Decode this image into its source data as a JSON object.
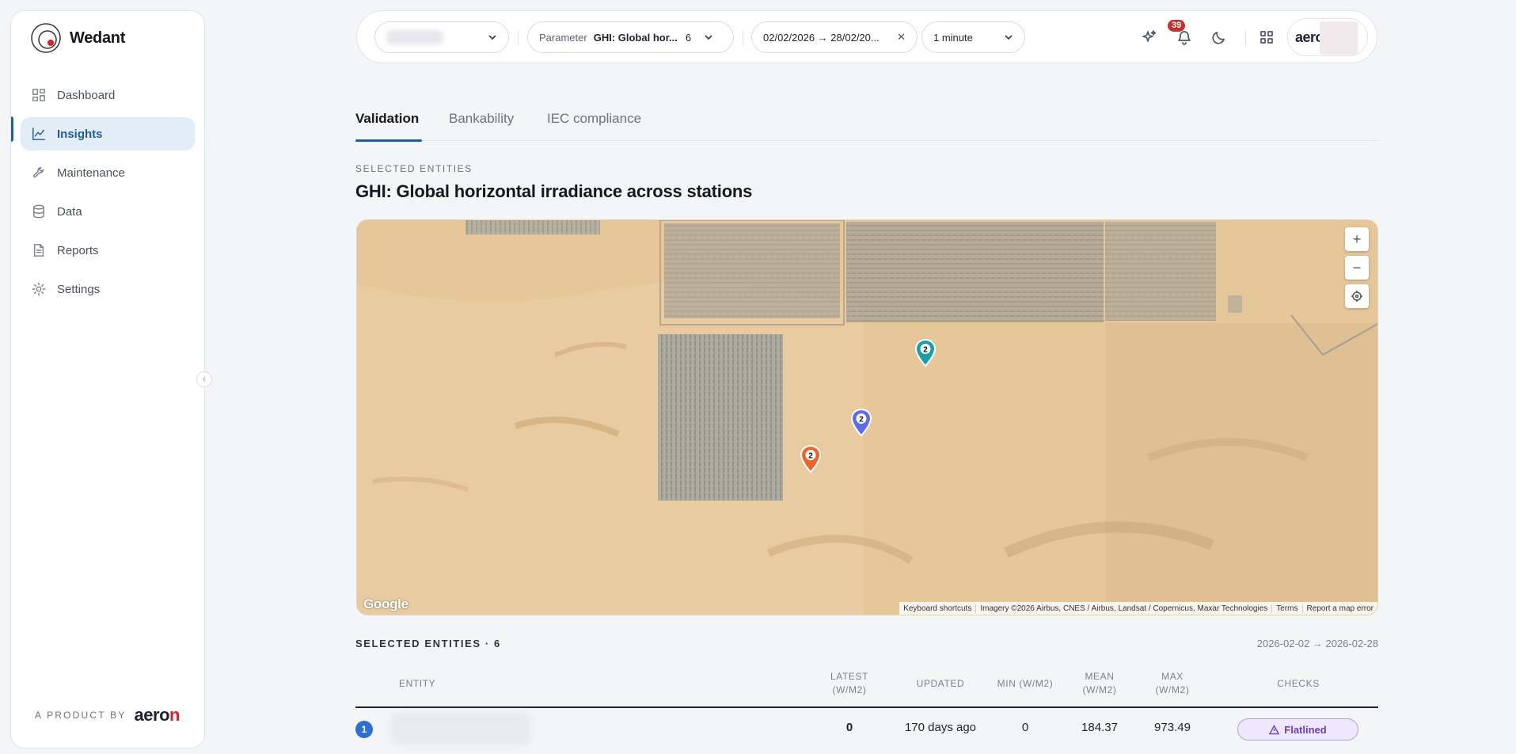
{
  "brand": {
    "name": "Wedant"
  },
  "sidebar": {
    "items": [
      {
        "label": "Dashboard",
        "icon": "dashboard-icon"
      },
      {
        "label": "Insights",
        "icon": "chart-line-icon",
        "active": true
      },
      {
        "label": "Maintenance",
        "icon": "wrench-icon"
      },
      {
        "label": "Data",
        "icon": "database-icon"
      },
      {
        "label": "Reports",
        "icon": "report-icon"
      },
      {
        "label": "Settings",
        "icon": "gear-icon"
      }
    ],
    "product_by": "A PRODUCT BY",
    "product_logo": {
      "prefix": "aero",
      "suffix": "n"
    }
  },
  "topbar": {
    "parameter_label": "Parameter",
    "parameter_value": "GHI: Global hor...",
    "parameter_count": "6",
    "date_range": "02/02/2026 → 28/02/20...",
    "interval": "1 minute",
    "notifications_count": "39",
    "account_logo": "aero"
  },
  "tabs": [
    {
      "label": "Validation",
      "active": true
    },
    {
      "label": "Bankability"
    },
    {
      "label": "IEC compliance"
    }
  ],
  "section": {
    "eyebrow": "SELECTED ENTITIES",
    "title": "GHI: Global horizontal irradiance across stations"
  },
  "map": {
    "zoom_in": "+",
    "zoom_out": "−",
    "google_logo": "Google",
    "attribution": [
      "Keyboard shortcuts",
      "Imagery ©2026 Airbus, CNES / Airbus, Landsat / Copernicus, Maxar Technologies",
      "Terms",
      "Report a map error"
    ],
    "markers": [
      {
        "count": "2",
        "color": "#17a0a8"
      },
      {
        "count": "2",
        "color": "#5b6cf0"
      },
      {
        "count": "2",
        "color": "#f1632c"
      }
    ]
  },
  "table": {
    "heading": "SELECTED ENTITIES · 6",
    "range": "2026-02-02 → 2026-02-28",
    "columns": {
      "entity": "ENTITY",
      "latest": "LATEST\n(W/M2)",
      "updated": "UPDATED",
      "min": "MIN (W/M2)",
      "mean": "MEAN\n(W/M2)",
      "max": "MAX\n(W/M2)",
      "checks": "CHECKS"
    },
    "rows": [
      {
        "index": "1",
        "latest": "0",
        "updated": "170 days ago",
        "min": "0",
        "mean": "184.37",
        "max": "973.49",
        "check": "Flatlined"
      }
    ]
  },
  "colors": {
    "accent": "#1f5e9b",
    "brand_red": "#d8232a",
    "flag_purple": "#6b3fb8",
    "badge_red": "#c9302c"
  }
}
